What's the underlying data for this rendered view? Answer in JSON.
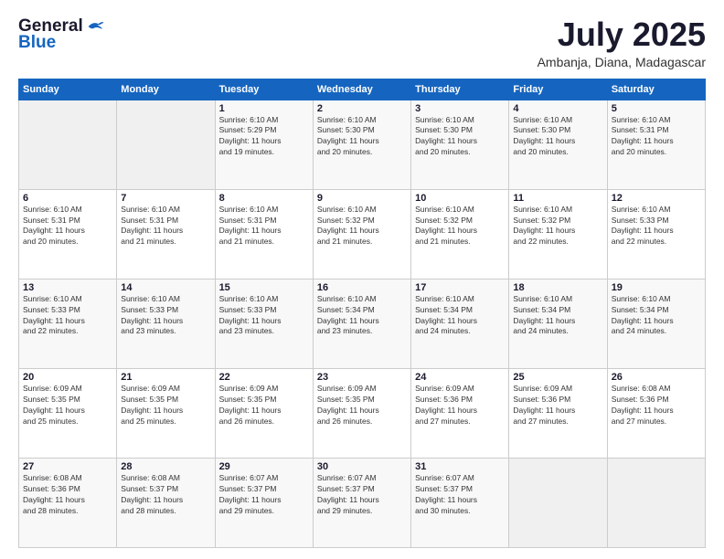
{
  "header": {
    "logo_general": "General",
    "logo_blue": "Blue",
    "month_title": "July 2025",
    "location": "Ambanja, Diana, Madagascar"
  },
  "weekdays": [
    "Sunday",
    "Monday",
    "Tuesday",
    "Wednesday",
    "Thursday",
    "Friday",
    "Saturday"
  ],
  "weeks": [
    [
      {
        "day": "",
        "info": ""
      },
      {
        "day": "",
        "info": ""
      },
      {
        "day": "1",
        "info": "Sunrise: 6:10 AM\nSunset: 5:29 PM\nDaylight: 11 hours\nand 19 minutes."
      },
      {
        "day": "2",
        "info": "Sunrise: 6:10 AM\nSunset: 5:30 PM\nDaylight: 11 hours\nand 20 minutes."
      },
      {
        "day": "3",
        "info": "Sunrise: 6:10 AM\nSunset: 5:30 PM\nDaylight: 11 hours\nand 20 minutes."
      },
      {
        "day": "4",
        "info": "Sunrise: 6:10 AM\nSunset: 5:30 PM\nDaylight: 11 hours\nand 20 minutes."
      },
      {
        "day": "5",
        "info": "Sunrise: 6:10 AM\nSunset: 5:31 PM\nDaylight: 11 hours\nand 20 minutes."
      }
    ],
    [
      {
        "day": "6",
        "info": "Sunrise: 6:10 AM\nSunset: 5:31 PM\nDaylight: 11 hours\nand 20 minutes."
      },
      {
        "day": "7",
        "info": "Sunrise: 6:10 AM\nSunset: 5:31 PM\nDaylight: 11 hours\nand 21 minutes."
      },
      {
        "day": "8",
        "info": "Sunrise: 6:10 AM\nSunset: 5:31 PM\nDaylight: 11 hours\nand 21 minutes."
      },
      {
        "day": "9",
        "info": "Sunrise: 6:10 AM\nSunset: 5:32 PM\nDaylight: 11 hours\nand 21 minutes."
      },
      {
        "day": "10",
        "info": "Sunrise: 6:10 AM\nSunset: 5:32 PM\nDaylight: 11 hours\nand 21 minutes."
      },
      {
        "day": "11",
        "info": "Sunrise: 6:10 AM\nSunset: 5:32 PM\nDaylight: 11 hours\nand 22 minutes."
      },
      {
        "day": "12",
        "info": "Sunrise: 6:10 AM\nSunset: 5:33 PM\nDaylight: 11 hours\nand 22 minutes."
      }
    ],
    [
      {
        "day": "13",
        "info": "Sunrise: 6:10 AM\nSunset: 5:33 PM\nDaylight: 11 hours\nand 22 minutes."
      },
      {
        "day": "14",
        "info": "Sunrise: 6:10 AM\nSunset: 5:33 PM\nDaylight: 11 hours\nand 23 minutes."
      },
      {
        "day": "15",
        "info": "Sunrise: 6:10 AM\nSunset: 5:33 PM\nDaylight: 11 hours\nand 23 minutes."
      },
      {
        "day": "16",
        "info": "Sunrise: 6:10 AM\nSunset: 5:34 PM\nDaylight: 11 hours\nand 23 minutes."
      },
      {
        "day": "17",
        "info": "Sunrise: 6:10 AM\nSunset: 5:34 PM\nDaylight: 11 hours\nand 24 minutes."
      },
      {
        "day": "18",
        "info": "Sunrise: 6:10 AM\nSunset: 5:34 PM\nDaylight: 11 hours\nand 24 minutes."
      },
      {
        "day": "19",
        "info": "Sunrise: 6:10 AM\nSunset: 5:34 PM\nDaylight: 11 hours\nand 24 minutes."
      }
    ],
    [
      {
        "day": "20",
        "info": "Sunrise: 6:09 AM\nSunset: 5:35 PM\nDaylight: 11 hours\nand 25 minutes."
      },
      {
        "day": "21",
        "info": "Sunrise: 6:09 AM\nSunset: 5:35 PM\nDaylight: 11 hours\nand 25 minutes."
      },
      {
        "day": "22",
        "info": "Sunrise: 6:09 AM\nSunset: 5:35 PM\nDaylight: 11 hours\nand 26 minutes."
      },
      {
        "day": "23",
        "info": "Sunrise: 6:09 AM\nSunset: 5:35 PM\nDaylight: 11 hours\nand 26 minutes."
      },
      {
        "day": "24",
        "info": "Sunrise: 6:09 AM\nSunset: 5:36 PM\nDaylight: 11 hours\nand 27 minutes."
      },
      {
        "day": "25",
        "info": "Sunrise: 6:09 AM\nSunset: 5:36 PM\nDaylight: 11 hours\nand 27 minutes."
      },
      {
        "day": "26",
        "info": "Sunrise: 6:08 AM\nSunset: 5:36 PM\nDaylight: 11 hours\nand 27 minutes."
      }
    ],
    [
      {
        "day": "27",
        "info": "Sunrise: 6:08 AM\nSunset: 5:36 PM\nDaylight: 11 hours\nand 28 minutes."
      },
      {
        "day": "28",
        "info": "Sunrise: 6:08 AM\nSunset: 5:37 PM\nDaylight: 11 hours\nand 28 minutes."
      },
      {
        "day": "29",
        "info": "Sunrise: 6:07 AM\nSunset: 5:37 PM\nDaylight: 11 hours\nand 29 minutes."
      },
      {
        "day": "30",
        "info": "Sunrise: 6:07 AM\nSunset: 5:37 PM\nDaylight: 11 hours\nand 29 minutes."
      },
      {
        "day": "31",
        "info": "Sunrise: 6:07 AM\nSunset: 5:37 PM\nDaylight: 11 hours\nand 30 minutes."
      },
      {
        "day": "",
        "info": ""
      },
      {
        "day": "",
        "info": ""
      }
    ]
  ]
}
